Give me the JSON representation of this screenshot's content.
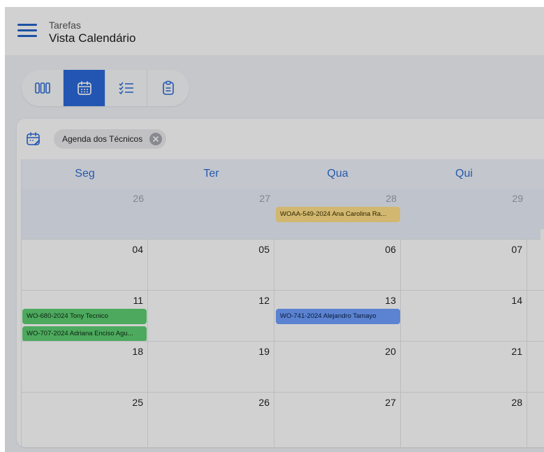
{
  "header": {
    "subtitle": "Tarefas",
    "title": "Vista Calendário"
  },
  "toolbar": {
    "views": [
      {
        "name": "board-view",
        "icon": "columns-icon",
        "active": false
      },
      {
        "name": "calendar-view",
        "icon": "calendar-icon",
        "active": true
      },
      {
        "name": "checklist-view",
        "icon": "checklist-icon",
        "active": false
      },
      {
        "name": "clipboard-view",
        "icon": "clipboard-icon",
        "active": false
      }
    ]
  },
  "calendar": {
    "filter_chip": "Agenda dos Técnicos",
    "day_headers": [
      "Seg",
      "Ter",
      "Qua",
      "Qui"
    ],
    "weeks": [
      {
        "dates": [
          "26",
          "27",
          "28",
          "29"
        ],
        "muted": true
      },
      {
        "dates": [
          "04",
          "05",
          "06",
          "07"
        ],
        "muted": false
      },
      {
        "dates": [
          "11",
          "12",
          "13",
          "14"
        ],
        "muted": false
      },
      {
        "dates": [
          "18",
          "19",
          "20",
          "21"
        ],
        "muted": false
      },
      {
        "dates": [
          "25",
          "26",
          "27",
          "28"
        ],
        "muted": false
      }
    ],
    "events": [
      {
        "label": "WOAA-549-2024 Ana Carolina Ra...",
        "color": "#ffe089",
        "week": 0,
        "day": 2
      },
      {
        "label": "WO-680-2024 Tony Tecnico",
        "color": "#5fcf73",
        "week": 2,
        "day": 0
      },
      {
        "label": "WO-707-2024 Adriana Enciso Agu...",
        "color": "#5fcf73",
        "week": 2,
        "day": 0
      },
      {
        "label": "WO-741-2024 Alejandro Tamayo",
        "color": "#6fa0ff",
        "week": 2,
        "day": 2
      }
    ]
  },
  "colors": {
    "accent": "#2a6ad9",
    "header_text": "#2e6fd6"
  }
}
